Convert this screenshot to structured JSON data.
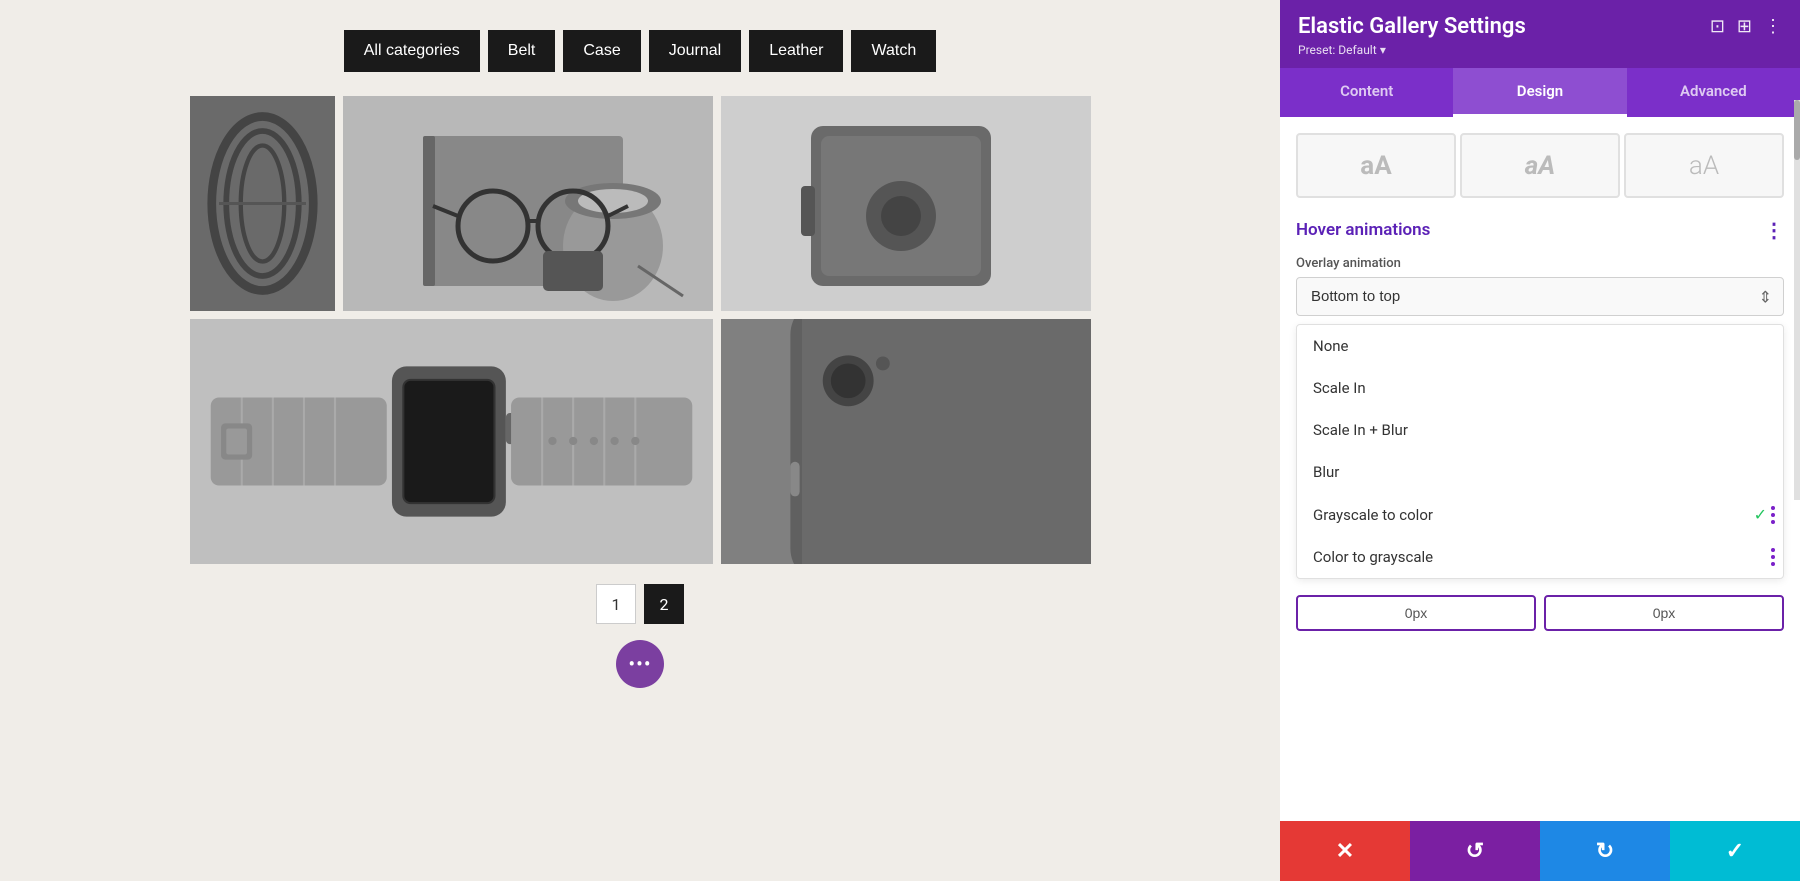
{
  "canvas": {
    "filter_buttons": [
      {
        "label": "All categories",
        "id": "all"
      },
      {
        "label": "Belt",
        "id": "belt"
      },
      {
        "label": "Case",
        "id": "case"
      },
      {
        "label": "Journal",
        "id": "journal"
      },
      {
        "label": "Leather",
        "id": "leather"
      },
      {
        "label": "Watch",
        "id": "watch"
      }
    ],
    "gallery_images": [
      {
        "id": 1,
        "alt": "Leather belt coiled"
      },
      {
        "id": 2,
        "alt": "Journal with glasses and coffee"
      },
      {
        "id": 3,
        "alt": "Leather camera case"
      },
      {
        "id": 4,
        "alt": "Smart watch with leather band"
      },
      {
        "id": 5,
        "alt": "Smartphone close up"
      }
    ],
    "pagination": [
      {
        "label": "1",
        "active": false
      },
      {
        "label": "2",
        "active": true
      }
    ],
    "fab_label": "•••"
  },
  "panel": {
    "title": "Elastic Gallery Settings",
    "preset": "Preset: Default",
    "preset_arrow": "▾",
    "icons": {
      "screen": "⊡",
      "layout": "⊞",
      "more": "⋮"
    },
    "tabs": [
      {
        "label": "Content",
        "active": false
      },
      {
        "label": "Design",
        "active": true
      },
      {
        "label": "Advanced",
        "active": false
      }
    ],
    "typography_options": [
      {
        "label": "aA",
        "style": "bold"
      },
      {
        "label": "aA",
        "style": "italic"
      },
      {
        "label": "aA",
        "style": "light"
      }
    ],
    "hover_animations": {
      "section_title": "Hover animations",
      "overlay_label": "Overlay animation",
      "current_value": "Bottom to top",
      "dropdown_options": [
        {
          "label": "None",
          "selected": false
        },
        {
          "label": "Scale In",
          "selected": false
        },
        {
          "label": "Scale In + Blur",
          "selected": false
        },
        {
          "label": "Blur",
          "selected": false
        },
        {
          "label": "Grayscale to color",
          "selected": true
        },
        {
          "label": "Color to grayscale",
          "selected": false
        }
      ]
    },
    "bottom_inputs": {
      "left_value": "0px",
      "right_value": "0px"
    },
    "action_buttons": {
      "cancel": "✕",
      "undo": "↺",
      "redo": "↻",
      "confirm": "✓"
    }
  }
}
